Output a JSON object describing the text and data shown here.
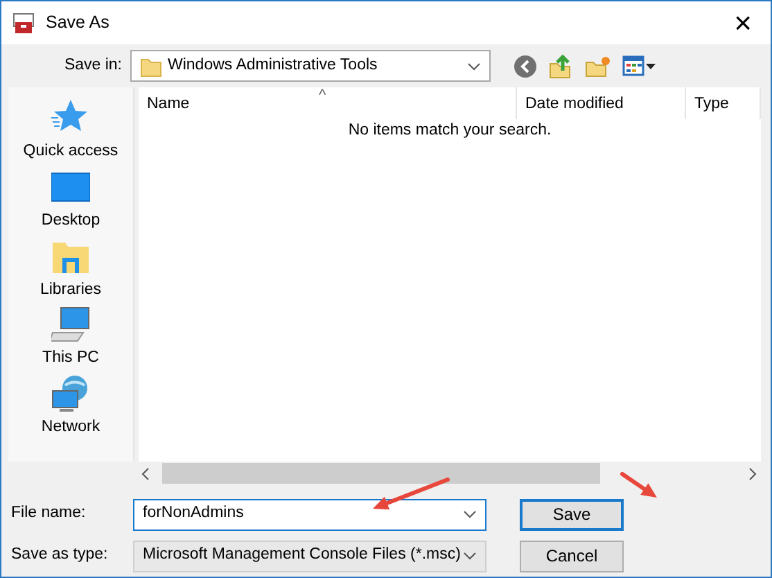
{
  "window": {
    "title": "Save As",
    "close": "×"
  },
  "save_in": {
    "label": "Save in:",
    "value": "Windows Administrative Tools"
  },
  "places": [
    {
      "label": "Quick access",
      "kind": "star"
    },
    {
      "label": "Desktop",
      "kind": "desktop"
    },
    {
      "label": "Libraries",
      "kind": "library"
    },
    {
      "label": "This PC",
      "kind": "pc"
    },
    {
      "label": "Network",
      "kind": "network"
    }
  ],
  "file_list": {
    "sort_indicator": "^",
    "columns": [
      "Name",
      "Date modified",
      "Type"
    ],
    "empty_message": "No items match your search."
  },
  "file_name": {
    "label": "File name:",
    "value": "forNonAdmins"
  },
  "save_as_type": {
    "label": "Save as type:",
    "value": "Microsoft Management Console Files (*.msc)"
  },
  "buttons": [
    "Save",
    "Cancel"
  ],
  "annotations": [
    {
      "kind": "arrow",
      "color": "#e8473c"
    },
    {
      "kind": "arrow",
      "color": "#e8473c"
    }
  ]
}
